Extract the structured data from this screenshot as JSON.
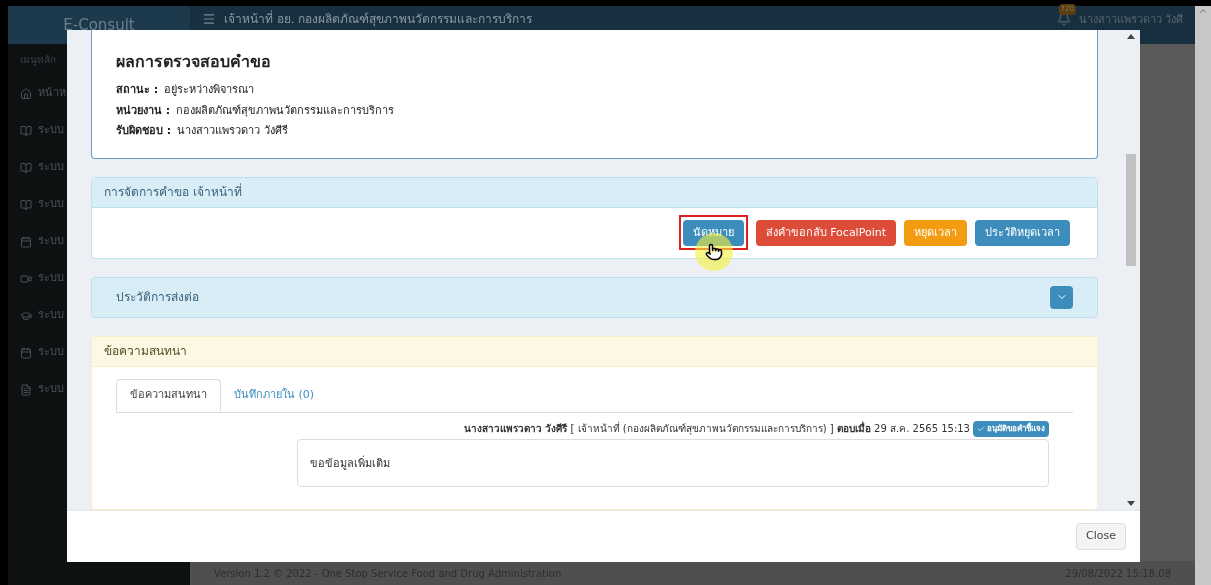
{
  "app": {
    "brand": "E-Consult",
    "header_title": "เจ้าหน้าที่ อย. กองผลิตภัณฑ์สุขภาพนวัตกรรมและการบริการ",
    "notification_count": "720",
    "user_name": "นางสาวแพรวดาว วังศี",
    "menu_label": "เมนูหลัก",
    "nav_items": [
      {
        "kind": "home",
        "label": "หน้าห"
      },
      {
        "kind": "book",
        "label": "ระบบ"
      },
      {
        "kind": "book",
        "label": "ระบบ"
      },
      {
        "kind": "book",
        "label": "ระบบ"
      },
      {
        "kind": "calendar",
        "label": "ระบบ"
      },
      {
        "kind": "video",
        "label": "ระบบ"
      },
      {
        "kind": "graduation",
        "label": "ระบบ"
      },
      {
        "kind": "calendar",
        "label": "ระบบ"
      },
      {
        "kind": "file",
        "label": "ระบบ"
      }
    ],
    "footer": "Version 1.2 © 2022 - One Stop Service Food and Drug Administration",
    "footer_time": "29/08/2022 15:18:08"
  },
  "modal": {
    "result": {
      "title": "ผลการตรวจสอบคำขอ",
      "fields": [
        {
          "label": "สถานะ :",
          "value": "อยู่ระหว่างพิจารณา"
        },
        {
          "label": "หน่วยงาน :",
          "value": "กองผลิตภัณฑ์สุขภาพนวัตกรรมและการบริการ"
        },
        {
          "label": "รับผิดชอบ :",
          "value": "นางสาวแพรวดาว วังศีรี"
        }
      ]
    },
    "actions": {
      "title": "การจัดการคำขอ เจ้าหน้าที่",
      "buttons": [
        {
          "label": "นัดหมาย",
          "color": "#3c8dbc",
          "selected": true
        },
        {
          "label": "ส่งคำขอกลับ FocalPoint",
          "color": "#dd4b39",
          "selected": false
        },
        {
          "label": "หยุดเวลา",
          "color": "#f39c12",
          "selected": false
        },
        {
          "label": "ประวัติหยุดเวลา",
          "color": "#3c8dbc",
          "selected": false
        }
      ]
    },
    "history": {
      "title": "ประวัติการส่งต่อ",
      "expanded": false
    },
    "chat": {
      "title": "ข้อความสนทนา",
      "tabs": [
        {
          "label": "ข้อความสนทนา",
          "selected": true
        },
        {
          "label": "บันทึกภายใน (0)",
          "selected": false
        }
      ],
      "messages": [
        {
          "header": "**นางสาวแพรวดาว วังศีรี** [ เจ้าหน้าที่ (กองผลิตภัณฑ์สุขภาพนวัตกรรมและการบริการ) ] **ตอบเมื่อ** 29 ส.ค. 2565 15:13",
          "badge": "อนุมัติขอคำชี้แจง",
          "body": "ขอข้อมูลเพิ่มเติม"
        }
      ]
    },
    "close_button": "Close"
  }
}
